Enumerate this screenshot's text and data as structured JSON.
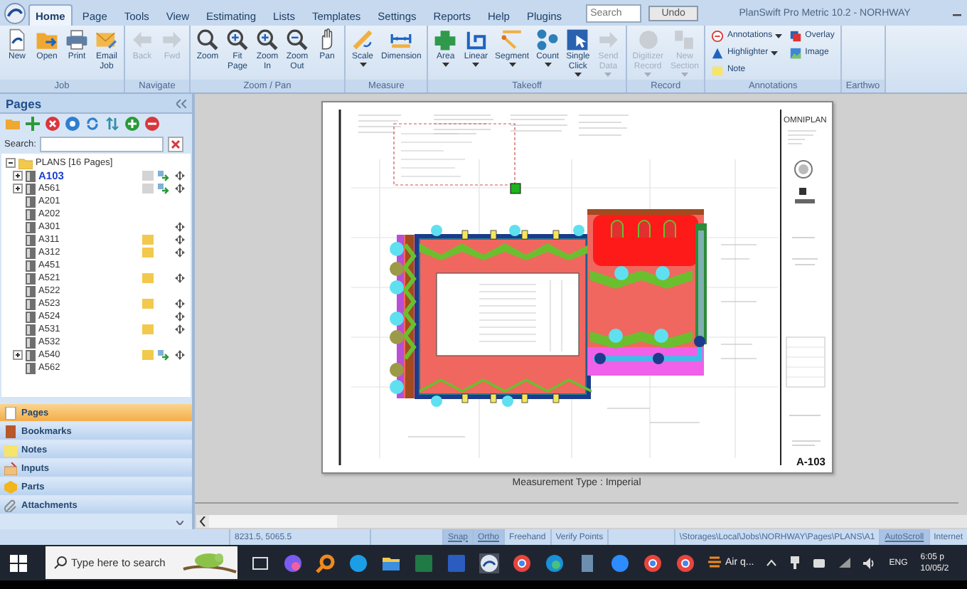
{
  "app": {
    "title": "PlanSwift Pro Metric 10.2 - NORHWAY",
    "search": {
      "placeholder": "Search"
    },
    "undo_button": "Undo"
  },
  "tabs": [
    {
      "label": "Home",
      "selected": true
    },
    {
      "label": "Page",
      "selected": false
    },
    {
      "label": "Tools",
      "selected": false
    },
    {
      "label": "View",
      "selected": false
    },
    {
      "label": "Estimating",
      "selected": false
    },
    {
      "label": "Lists",
      "selected": false
    },
    {
      "label": "Templates",
      "selected": false
    },
    {
      "label": "Settings",
      "selected": false
    },
    {
      "label": "Reports",
      "selected": false
    },
    {
      "label": "Help",
      "selected": false
    },
    {
      "label": "Plugins",
      "selected": false
    }
  ],
  "ribbon": [
    {
      "label": "Job",
      "buttons": [
        {
          "label": "New",
          "kind": "large",
          "disabled": false,
          "dropdown": false
        },
        {
          "label": "Open",
          "kind": "large",
          "disabled": false,
          "dropdown": false
        },
        {
          "label": "Print",
          "kind": "large",
          "disabled": false,
          "dropdown": false
        },
        {
          "label": "Email Job",
          "kind": "large",
          "disabled": false,
          "dropdown": false
        }
      ]
    },
    {
      "label": "Navigate",
      "buttons": [
        {
          "label": "Back",
          "kind": "large",
          "disabled": true,
          "dropdown": false
        },
        {
          "label": "Fwd",
          "kind": "large",
          "disabled": true,
          "dropdown": false
        }
      ]
    },
    {
      "label": "Zoom / Pan",
      "buttons": [
        {
          "label": "Zoom",
          "kind": "large",
          "disabled": false,
          "dropdown": false
        },
        {
          "label": "Fit Page",
          "kind": "large",
          "disabled": false,
          "dropdown": false
        },
        {
          "label": "Zoom In",
          "kind": "large",
          "disabled": false,
          "dropdown": false
        },
        {
          "label": "Zoom Out",
          "kind": "large",
          "disabled": false,
          "dropdown": false
        },
        {
          "label": "Pan",
          "kind": "large",
          "disabled": false,
          "dropdown": false
        }
      ]
    },
    {
      "label": "Measure",
      "buttons": [
        {
          "label": "Scale",
          "kind": "large",
          "disabled": false,
          "dropdown": true
        },
        {
          "label": "Dimension",
          "kind": "large",
          "disabled": false,
          "dropdown": false
        }
      ]
    },
    {
      "label": "Takeoff",
      "buttons": [
        {
          "label": "Area",
          "kind": "large",
          "disabled": false,
          "dropdown": true
        },
        {
          "label": "Linear",
          "kind": "large",
          "disabled": false,
          "dropdown": true
        },
        {
          "label": "Segment",
          "kind": "large",
          "disabled": false,
          "dropdown": true
        },
        {
          "label": "Count",
          "kind": "large",
          "disabled": false,
          "dropdown": true
        },
        {
          "label": "Single Click",
          "kind": "large",
          "disabled": false,
          "dropdown": true
        },
        {
          "label": "Send Data",
          "kind": "large",
          "disabled": true,
          "dropdown": true
        }
      ]
    },
    {
      "label": "Record",
      "buttons": [
        {
          "label": "Digitizer Record",
          "kind": "large",
          "disabled": true,
          "dropdown": true
        },
        {
          "label": "New Section",
          "kind": "large",
          "disabled": true,
          "dropdown": true
        }
      ]
    },
    {
      "label": "Annotations",
      "buttons": [
        {
          "label": "Annotations",
          "kind": "small",
          "disabled": false,
          "dropdown": true
        },
        {
          "label": "Highlighter",
          "kind": "small",
          "disabled": false,
          "dropdown": true
        },
        {
          "label": "Note",
          "kind": "small",
          "disabled": false,
          "dropdown": false
        },
        {
          "label": "Overlay",
          "kind": "small",
          "disabled": false,
          "dropdown": false
        },
        {
          "label": "Image",
          "kind": "small",
          "disabled": false,
          "dropdown": false
        }
      ]
    },
    {
      "label": "Earthwo"
    }
  ],
  "pages_panel": {
    "title": "Pages",
    "search_label": "Search:",
    "root": {
      "label": "PLANS [16 Pages]",
      "expanded": true,
      "children": [
        {
          "label": "A103",
          "selected": true,
          "collapsed": true,
          "color": "#d4d4d4",
          "linked": true,
          "movable": true
        },
        {
          "label": "A561",
          "selected": false,
          "collapsed": true,
          "color": "#d4d4d4",
          "linked": true,
          "movable": true
        },
        {
          "label": "A201",
          "selected": false,
          "collapsed": false,
          "linked": false,
          "movable": false
        },
        {
          "label": "A202",
          "selected": false,
          "collapsed": false,
          "linked": false,
          "movable": false
        },
        {
          "label": "A301",
          "selected": false,
          "collapsed": false,
          "linked": false,
          "movable": true
        },
        {
          "label": "A311",
          "selected": false,
          "collapsed": false,
          "color": "#f2c94c",
          "linked": false,
          "movable": true
        },
        {
          "label": "A312",
          "selected": false,
          "collapsed": false,
          "color": "#f2c94c",
          "linked": false,
          "movable": true
        },
        {
          "label": "A451",
          "selected": false,
          "collapsed": false,
          "linked": false,
          "movable": false
        },
        {
          "label": "A521",
          "selected": false,
          "collapsed": false,
          "color": "#f2c94c",
          "linked": false,
          "movable": true
        },
        {
          "label": "A522",
          "selected": false,
          "collapsed": false,
          "linked": false,
          "movable": false
        },
        {
          "label": "A523",
          "selected": false,
          "collapsed": false,
          "color": "#f2c94c",
          "linked": false,
          "movable": true
        },
        {
          "label": "A524",
          "selected": false,
          "collapsed": false,
          "linked": false,
          "movable": true
        },
        {
          "label": "A531",
          "selected": false,
          "collapsed": false,
          "color": "#f2c94c",
          "linked": false,
          "movable": true
        },
        {
          "label": "A532",
          "selected": false,
          "collapsed": false,
          "linked": false,
          "movable": false
        },
        {
          "label": "A540",
          "selected": false,
          "collapsed": true,
          "color": "#f2c94c",
          "linked": true,
          "movable": true
        },
        {
          "label": "A562",
          "selected": false,
          "collapsed": false,
          "linked": false,
          "movable": false
        }
      ]
    }
  },
  "nav": [
    {
      "label": "Pages",
      "selected": true
    },
    {
      "label": "Bookmarks",
      "selected": false
    },
    {
      "label": "Notes",
      "selected": false
    },
    {
      "label": "Inputs",
      "selected": false
    },
    {
      "label": "Parts",
      "selected": false
    },
    {
      "label": "Attachments",
      "selected": false
    }
  ],
  "canvas": {
    "sheet": {
      "firm": "OMNIPLAN",
      "sheet_number": "A-103"
    },
    "measurement_type": "Measurement Type : Imperial"
  },
  "status_bar": {
    "coordinates": "8231.5, 5065.5",
    "toggles": [
      {
        "label": "Snap",
        "on": true
      },
      {
        "label": "Ortho",
        "on": true
      },
      {
        "label": "Freehand",
        "on": false
      },
      {
        "label": "Verify Points",
        "on": false
      }
    ],
    "path": "\\Storages\\Local\\Jobs\\NORHWAY\\Pages\\PLANS\\A1",
    "autoscroll": {
      "label": "AutoScroll",
      "on": true
    },
    "connection": "Internet"
  },
  "taskbar": {
    "search": {
      "placeholder": "Type here to search"
    },
    "weather": "Air q...",
    "language": "ENG",
    "time": "6:05 p",
    "date": "10/05/2"
  }
}
